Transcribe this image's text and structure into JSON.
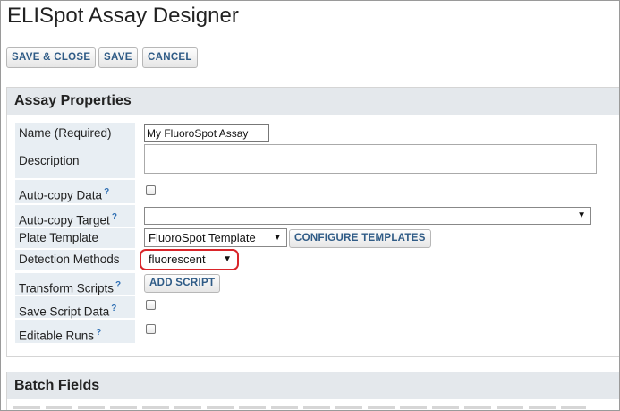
{
  "page": {
    "title": "ELISpot Assay Designer"
  },
  "toolbar": {
    "save_close_label": "SAVE & CLOSE",
    "save_label": "SAVE",
    "cancel_label": "CANCEL"
  },
  "assay_properties": {
    "header": "Assay Properties",
    "name_label": "Name (Required)",
    "name_value": "My FluoroSpot Assay",
    "description_label": "Description",
    "description_value": "",
    "auto_copy_data_label": "Auto-copy Data",
    "auto_copy_data_checked": false,
    "auto_copy_target_label": "Auto-copy Target",
    "auto_copy_target_value": "",
    "plate_template_label": "Plate Template",
    "plate_template_value": "FluoroSpot Template",
    "configure_templates_label": "CONFIGURE TEMPLATES",
    "detection_methods_label": "Detection Methods",
    "detection_methods_value": "fluorescent",
    "transform_scripts_label": "Transform Scripts",
    "add_script_label": "ADD SCRIPT",
    "save_script_data_label": "Save Script Data",
    "save_script_data_checked": false,
    "editable_runs_label": "Editable Runs",
    "editable_runs_checked": false,
    "help_glyph": "?"
  },
  "batch_fields": {
    "header": "Batch Fields"
  },
  "colors": {
    "accent": "#2f5b86",
    "highlight": "#d9252a",
    "label_bg": "#e8eef3",
    "header_bg": "#e4e8ec"
  },
  "icons": {
    "dropdown": "caret-down-icon",
    "help": "help-icon"
  }
}
